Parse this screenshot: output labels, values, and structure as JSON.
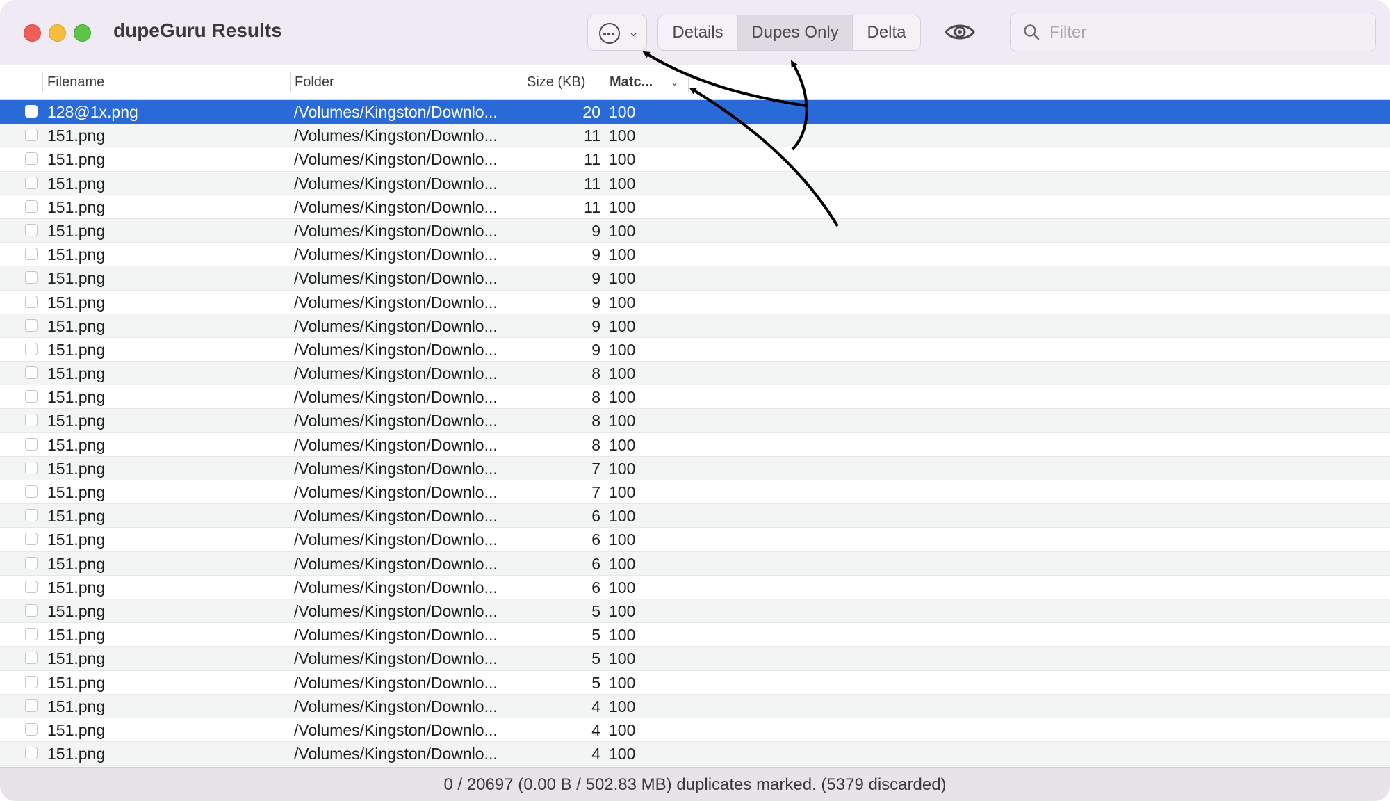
{
  "window": {
    "title": "dupeGuru Results"
  },
  "toolbar": {
    "action_icon": "ellipsis-circle-icon",
    "action_chevron": "chevron-down-icon",
    "segments": [
      "Details",
      "Dupes Only",
      "Delta"
    ],
    "selected_segment": "Dupes Only",
    "preview_icon": "eye-icon",
    "filter_placeholder": "Filter"
  },
  "table": {
    "columns": [
      "Filename",
      "Folder",
      "Size (KB)",
      "Matc..."
    ],
    "sorted_column": "Matc...",
    "rows": [
      {
        "name": "128@1x.png",
        "folder": "/Volumes/Kingston/Downlo...",
        "size": "20",
        "match": "100",
        "selected": true
      },
      {
        "name": "151.png",
        "folder": "/Volumes/Kingston/Downlo...",
        "size": "11",
        "match": "100"
      },
      {
        "name": "151.png",
        "folder": "/Volumes/Kingston/Downlo...",
        "size": "11",
        "match": "100"
      },
      {
        "name": "151.png",
        "folder": "/Volumes/Kingston/Downlo...",
        "size": "11",
        "match": "100"
      },
      {
        "name": "151.png",
        "folder": "/Volumes/Kingston/Downlo...",
        "size": "11",
        "match": "100"
      },
      {
        "name": "151.png",
        "folder": "/Volumes/Kingston/Downlo...",
        "size": "9",
        "match": "100"
      },
      {
        "name": "151.png",
        "folder": "/Volumes/Kingston/Downlo...",
        "size": "9",
        "match": "100"
      },
      {
        "name": "151.png",
        "folder": "/Volumes/Kingston/Downlo...",
        "size": "9",
        "match": "100"
      },
      {
        "name": "151.png",
        "folder": "/Volumes/Kingston/Downlo...",
        "size": "9",
        "match": "100"
      },
      {
        "name": "151.png",
        "folder": "/Volumes/Kingston/Downlo...",
        "size": "9",
        "match": "100"
      },
      {
        "name": "151.png",
        "folder": "/Volumes/Kingston/Downlo...",
        "size": "9",
        "match": "100"
      },
      {
        "name": "151.png",
        "folder": "/Volumes/Kingston/Downlo...",
        "size": "8",
        "match": "100"
      },
      {
        "name": "151.png",
        "folder": "/Volumes/Kingston/Downlo...",
        "size": "8",
        "match": "100"
      },
      {
        "name": "151.png",
        "folder": "/Volumes/Kingston/Downlo...",
        "size": "8",
        "match": "100"
      },
      {
        "name": "151.png",
        "folder": "/Volumes/Kingston/Downlo...",
        "size": "8",
        "match": "100"
      },
      {
        "name": "151.png",
        "folder": "/Volumes/Kingston/Downlo...",
        "size": "7",
        "match": "100"
      },
      {
        "name": "151.png",
        "folder": "/Volumes/Kingston/Downlo...",
        "size": "7",
        "match": "100"
      },
      {
        "name": "151.png",
        "folder": "/Volumes/Kingston/Downlo...",
        "size": "6",
        "match": "100"
      },
      {
        "name": "151.png",
        "folder": "/Volumes/Kingston/Downlo...",
        "size": "6",
        "match": "100"
      },
      {
        "name": "151.png",
        "folder": "/Volumes/Kingston/Downlo...",
        "size": "6",
        "match": "100"
      },
      {
        "name": "151.png",
        "folder": "/Volumes/Kingston/Downlo...",
        "size": "6",
        "match": "100"
      },
      {
        "name": "151.png",
        "folder": "/Volumes/Kingston/Downlo...",
        "size": "5",
        "match": "100"
      },
      {
        "name": "151.png",
        "folder": "/Volumes/Kingston/Downlo...",
        "size": "5",
        "match": "100"
      },
      {
        "name": "151.png",
        "folder": "/Volumes/Kingston/Downlo...",
        "size": "5",
        "match": "100"
      },
      {
        "name": "151.png",
        "folder": "/Volumes/Kingston/Downlo...",
        "size": "5",
        "match": "100"
      },
      {
        "name": "151.png",
        "folder": "/Volumes/Kingston/Downlo...",
        "size": "4",
        "match": "100"
      },
      {
        "name": "151.png",
        "folder": "/Volumes/Kingston/Downlo...",
        "size": "4",
        "match": "100"
      },
      {
        "name": "151.png",
        "folder": "/Volumes/Kingston/Downlo...",
        "size": "4",
        "match": "100"
      }
    ]
  },
  "status": {
    "text": "0 / 20697 (0.00 B / 502.83 MB) duplicates marked. (5379 discarded)"
  },
  "colors": {
    "selection": "#2a6ad8",
    "toolbar_bg": "#efeaf3",
    "row_alt": "#f3f5f5"
  }
}
